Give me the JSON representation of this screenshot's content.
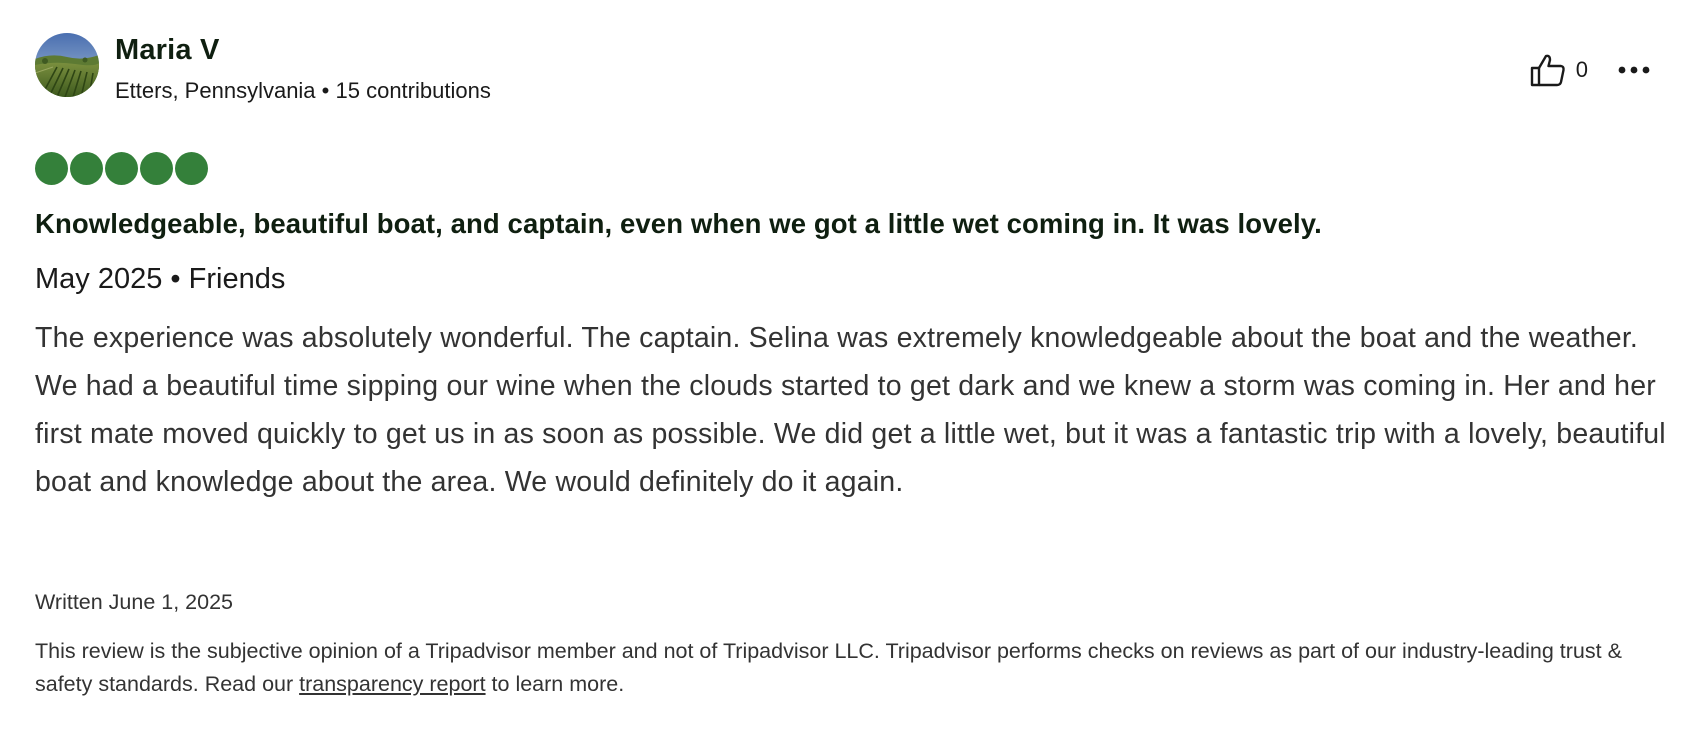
{
  "user": {
    "name": "Maria V",
    "location": "Etters, Pennsylvania",
    "separator": "•",
    "contributions": "15 contributions",
    "avatar_icon": "vineyard-landscape-avatar"
  },
  "actions": {
    "helpful_icon": "thumbs-up-icon",
    "helpful_count": "0",
    "more_icon": "more-options-icon"
  },
  "rating": {
    "value": 5,
    "max": 5,
    "color": "#34803a"
  },
  "review": {
    "title": "Knowledgeable, beautiful boat, and captain, even when we got a little wet coming in. It was lovely.",
    "date_trip": "May 2025 • Friends",
    "body": "The experience was absolutely wonderful. The captain. Selina was extremely knowledgeable about the boat and the weather. We had a beautiful time sipping our wine when the clouds started to get dark and we knew a storm was coming in. Her and her first mate moved quickly to get us in as soon as possible. We did get a little wet, but it was a fantastic trip with a lovely, beautiful boat and knowledge about the area. We would definitely do it again.",
    "written": "Written June 1, 2025"
  },
  "disclaimer": {
    "text_before": "This review is the subjective opinion of a Tripadvisor member and not of Tripadvisor LLC. Tripadvisor performs checks on reviews as part of our industry-leading trust & safety standards. Read our ",
    "link_text": "transparency report",
    "text_after": " to learn more."
  }
}
